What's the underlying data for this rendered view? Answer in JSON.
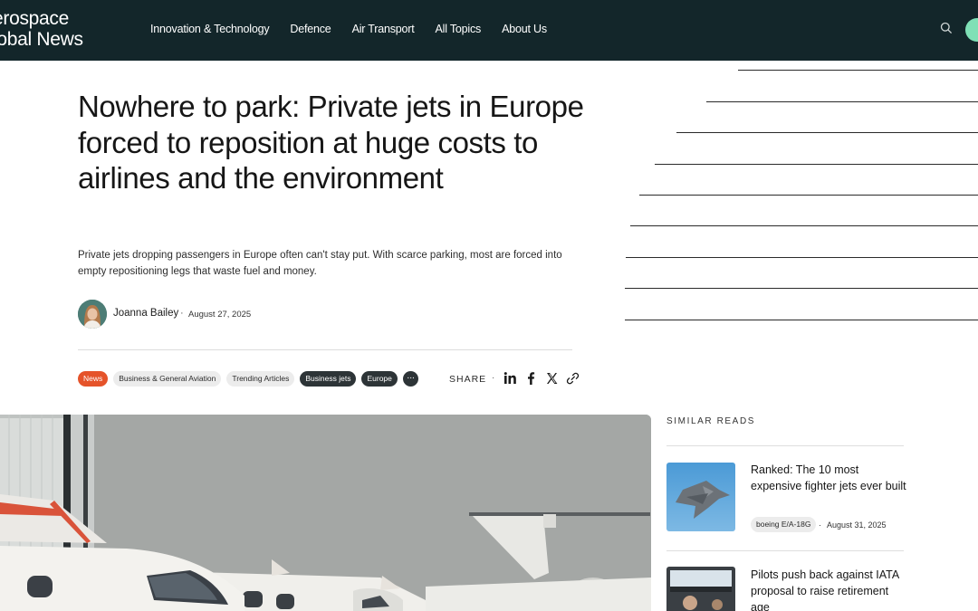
{
  "header": {
    "logo_line1": "erospace",
    "logo_line2": "lobal News",
    "nav": [
      "Innovation & Technology",
      "Defence",
      "Air Transport",
      "All Topics",
      "About Us"
    ]
  },
  "article": {
    "headline": "Nowhere to park: Private jets in Europe forced to reposition at huge costs to airlines and the environment",
    "dek": "Private jets dropping passengers in Europe often can't stay put. With scarce parking, most are forced into empty repositioning legs that waste fuel and money.",
    "author": "Joanna Bailey",
    "separator": "·",
    "date": "August 27, 2025",
    "tags": [
      "News",
      "Business & General Aviation",
      "Trending Articles",
      "Business jets",
      "Europe"
    ],
    "more_tags": "···",
    "share_label": "SHARE",
    "share_separator": "·"
  },
  "similar": {
    "title": "SIMILAR READS",
    "items": [
      {
        "headline": "Ranked: The 10 most expensive fighter jets ever built",
        "tag": "boeing E/A-18G",
        "separator": "·",
        "date": "August 31, 2025"
      },
      {
        "headline": "Pilots push back against IATA proposal to raise retirement age",
        "tag": "",
        "separator": "",
        "date": ""
      }
    ]
  },
  "icons": {
    "search": "search-icon",
    "linkedin": "linkedin-icon",
    "facebook": "facebook-icon",
    "x": "x-icon",
    "link": "link-icon"
  },
  "colors": {
    "header_bg": "#13262a",
    "accent": "#7fe0b6",
    "news_tag": "#e5532a"
  }
}
